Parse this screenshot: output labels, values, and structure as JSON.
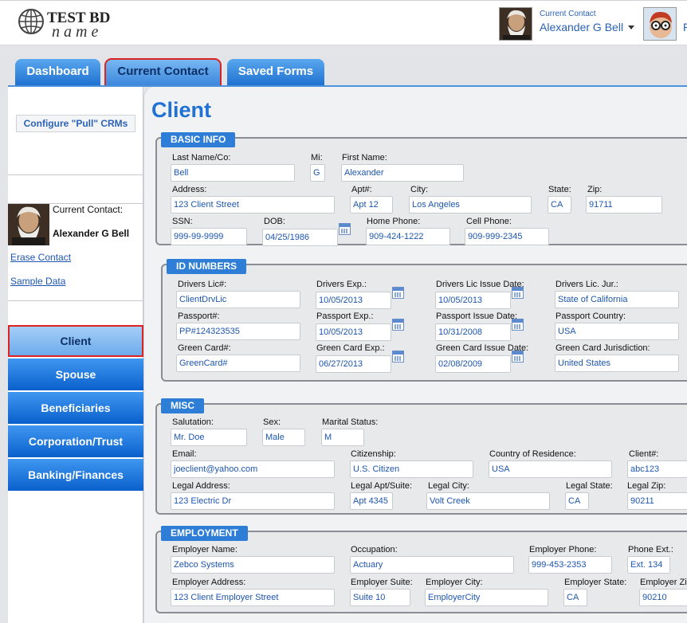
{
  "header": {
    "logo_line1": "TEST BD",
    "logo_line2": "name",
    "current_contact_label": "Current Contact",
    "current_contact_name": "Alexander G Bell",
    "cut_text": "F"
  },
  "tabs": [
    "Dashboard",
    "Current Contact",
    "Saved Forms"
  ],
  "sidebar": {
    "configure_button": "Configure \"Pull\" CRMs",
    "current_contact_label": "Current Contact:",
    "contact_name": "Alexander G Bell",
    "erase_link": "Erase Contact",
    "sample_link": "Sample Data",
    "nav": [
      "Client",
      "Spouse",
      "Beneficiaries",
      "Corporation/Trust",
      "Banking/Finances"
    ]
  },
  "page_title": "Client",
  "basic": {
    "title": "BASIC INFO",
    "last_name_label": "Last Name/Co:",
    "last_name": "Bell",
    "mi_label": "Mi:",
    "mi": "G",
    "first_name_label": "First Name:",
    "first_name": "Alexander",
    "address_label": "Address:",
    "address": "123 Client Street",
    "apt_label": "Apt#:",
    "apt": "Apt 12",
    "city_label": "City:",
    "city": "Los Angeles",
    "state_label": "State:",
    "state": "CA",
    "zip_label": "Zip:",
    "zip": "91711",
    "ssn_label": "SSN:",
    "ssn": "999-99-9999",
    "dob_label": "DOB:",
    "dob": "04/25/1986",
    "home_phone_label": "Home Phone:",
    "home_phone": "909-424-1222",
    "cell_phone_label": "Cell Phone:",
    "cell_phone": "909-999-2345"
  },
  "id_numbers": {
    "title": "ID NUMBERS",
    "drivers_lic_label": "Drivers Lic#:",
    "drivers_lic": "ClientDrvLic",
    "drivers_exp_label": "Drivers Exp.:",
    "drivers_exp": "10/05/2013",
    "drivers_issue_label": "Drivers Lic Issue Date:",
    "drivers_issue": "10/05/2013",
    "drivers_jur_label": "Drivers Lic. Jur.:",
    "drivers_jur": "State of California",
    "passport_label": "Passport#:",
    "passport": "PP#124323535",
    "passport_exp_label": "Passport Exp.:",
    "passport_exp": "10/05/2013",
    "passport_issue_label": "Passport Issue Date:",
    "passport_issue": "10/31/2008",
    "passport_country_label": "Passport Country:",
    "passport_country": "USA",
    "green_card_label": "Green Card#:",
    "green_card": "GreenCard#",
    "green_card_exp_label": "Green Card Exp.:",
    "green_card_exp": "06/27/2013",
    "green_card_issue_label": "Green Card Issue Date:",
    "green_card_issue": "02/08/2009",
    "green_card_jur_label": "Green Card Jurisdiction:",
    "green_card_jur": "United States"
  },
  "misc": {
    "title": "MISC",
    "salutation_label": "Salutation:",
    "salutation": "Mr. Doe",
    "sex_label": "Sex:",
    "sex": "Male",
    "marital_label": "Marital Status:",
    "marital": "M",
    "email_label": "Email:",
    "email": "joeclient@yahoo.com",
    "citizenship_label": "Citizenship:",
    "citizenship": "U.S. Citizen",
    "country_label": "Country of Residence:",
    "country": "USA",
    "client_no_label": "Client#:",
    "client_no": "abc123",
    "legal_address_label": "Legal Address:",
    "legal_address": "123 Electric Dr",
    "legal_apt_label": "Legal Apt/Suite:",
    "legal_apt": "Apt 4345",
    "legal_city_label": "Legal City:",
    "legal_city": "Volt Creek",
    "legal_state_label": "Legal State:",
    "legal_state": "CA",
    "legal_zip_label": "Legal Zip:",
    "legal_zip": "90211"
  },
  "employment": {
    "title": "EMPLOYMENT",
    "employer_name_label": "Employer Name:",
    "employer_name": "Zebco Systems",
    "occupation_label": "Occupation:",
    "occupation": "Actuary",
    "employer_phone_label": "Employer Phone:",
    "employer_phone": "999-453-2353",
    "phone_ext_label": "Phone Ext.:",
    "phone_ext": "Ext. 134",
    "employer_address_label": "Employer Address:",
    "employer_address": "123 Client Employer Street",
    "employer_suite_label": "Employer Suite:",
    "employer_suite": "Suite 10",
    "employer_city_label": "Employer City:",
    "employer_city": "EmployerCity",
    "employer_state_label": "Employer State:",
    "employer_state": "CA",
    "employer_zip_label": "Employer Zip:",
    "employer_zip": "90210"
  }
}
